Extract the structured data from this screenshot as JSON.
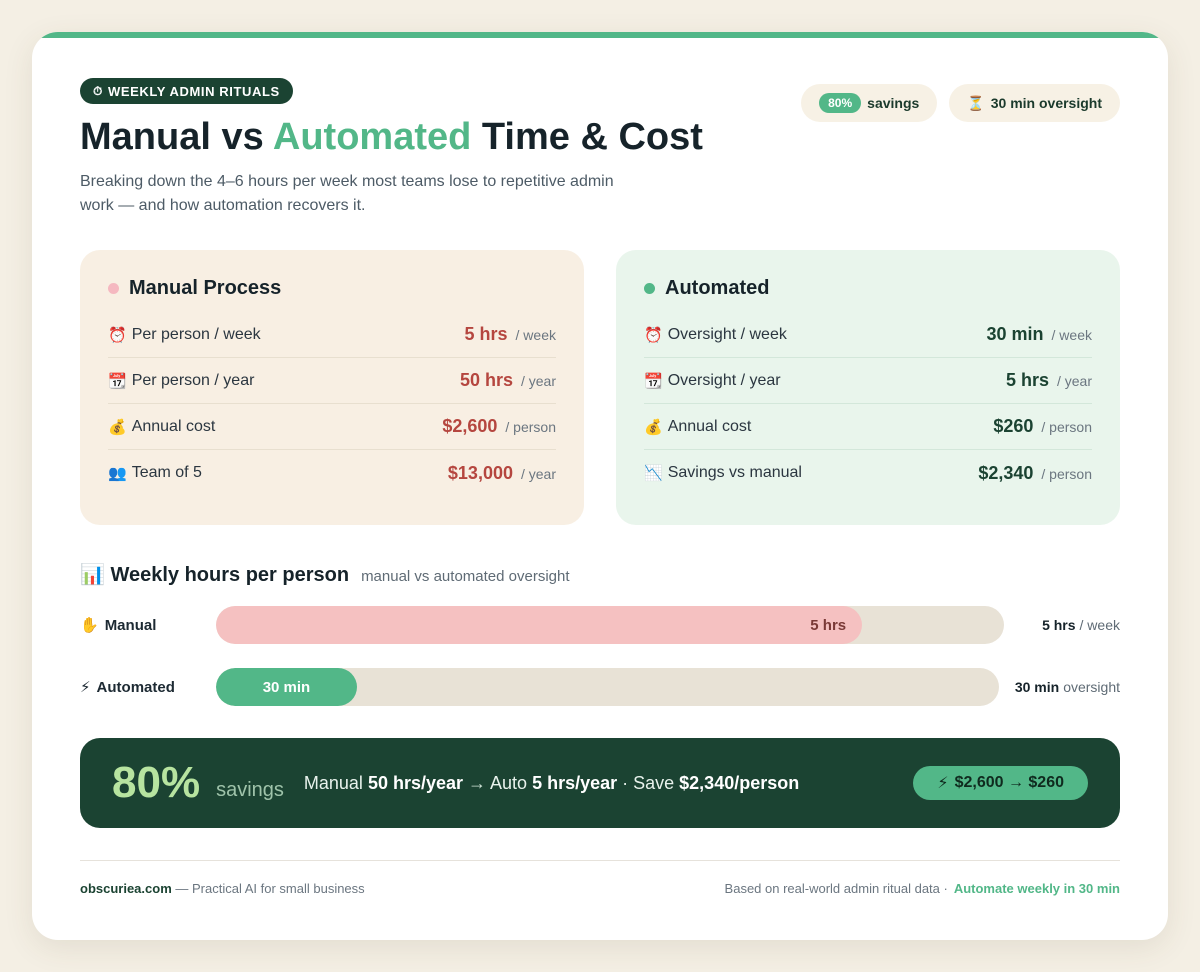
{
  "header": {
    "kicker_icon": "⏱",
    "kicker_label": "WEEKLY ADMIN RITUALS",
    "title_start": "Manual vs ",
    "title_accent": "Automated",
    "title_end": " Time & Cost",
    "subtitle": "Breaking down the 4–6 hours per week most teams lose to repetitive admin work — and how automation recovers it.",
    "pills": {
      "savings_value": "80%",
      "savings_label": "savings",
      "oversight_icon": "⏳",
      "oversight_label": "30 min oversight"
    }
  },
  "manual": {
    "title": "Manual Process",
    "rows": [
      {
        "icon": "⏰",
        "label": "Per person / week",
        "value": "5 hrs",
        "unit": "/ week"
      },
      {
        "icon": "📆",
        "label": "Per person / year",
        "value": "50 hrs",
        "unit": "/ year"
      },
      {
        "icon": "💰",
        "label": "Annual cost",
        "value": "$2,600",
        "unit": "/ person"
      },
      {
        "icon": "👥",
        "label": "Team of 5",
        "value": "$13,000",
        "unit": "/ year"
      }
    ]
  },
  "automated": {
    "title": "Automated",
    "rows": [
      {
        "icon": "⏰",
        "label": "Oversight / week",
        "value": "30 min",
        "unit": "/ week"
      },
      {
        "icon": "📆",
        "label": "Oversight / year",
        "value": "5 hrs",
        "unit": "/ year"
      },
      {
        "icon": "💰",
        "label": "Annual cost",
        "value": "$260",
        "unit": "/ person"
      },
      {
        "icon": "📉",
        "label": "Savings vs manual",
        "value": "$2,340",
        "unit": "/ person"
      }
    ]
  },
  "bars": {
    "icon": "📊",
    "title": "Weekly hours per person",
    "subtitle": "manual vs automated oversight",
    "manual": {
      "icon": "✋",
      "label": "Manual",
      "bar_text": "5 hrs",
      "end_value": "5 hrs",
      "end_unit": "/ week",
      "fill_fraction": 0.82
    },
    "automated": {
      "icon": "⚡",
      "label": "Automated",
      "bar_text": "30 min",
      "end_value": "30 min",
      "end_unit": "oversight",
      "fill_fraction": 0.18
    }
  },
  "banner": {
    "big": "80%",
    "big_label": "savings",
    "s1": "Manual ",
    "s2": "50 hrs/year",
    "arrow": " → ",
    "s3": "Auto ",
    "s4": "5 hrs/year",
    "s5": " · Save ",
    "s6": "$2,340/person",
    "chip_icon": "⚡",
    "chip_text": "$2,600 → $260"
  },
  "footer": {
    "brand": "obscuriea.com",
    "tagline": " — Practical AI for small business",
    "note": "Based on real-world admin ritual data ·",
    "cta": "Automate weekly in 30 min"
  },
  "colors": {
    "accent": "#52b788",
    "dark_green": "#1b4332",
    "manual_red": "#b5463f",
    "manual_bar": "#f5c1c1"
  }
}
